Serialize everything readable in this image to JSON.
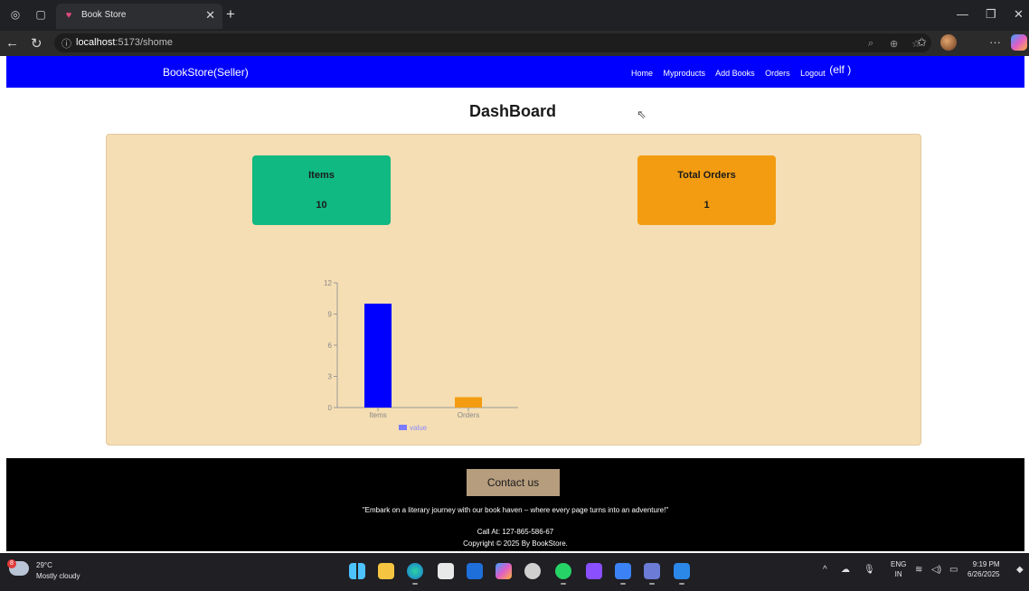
{
  "browser": {
    "tab_title": "Book Store",
    "url_host": "localhost",
    "url_rest": ":5173/shome"
  },
  "navbar": {
    "brand": "BookStore(Seller)",
    "links": [
      "Home",
      "Myproducts",
      "Add Books",
      "Orders",
      "Logout"
    ],
    "logout_suffix": "(elf )"
  },
  "dashboard": {
    "title": "DashBoard",
    "cards": [
      {
        "label": "Items",
        "value": "10",
        "color": "#10b981"
      },
      {
        "label": "Total Orders",
        "value": "1",
        "color": "#f39c12"
      }
    ]
  },
  "chart_data": {
    "type": "bar",
    "categories": [
      "Items",
      "Orders"
    ],
    "values": [
      10,
      1
    ],
    "bar_colors": [
      "#0000ff",
      "#f39c12"
    ],
    "yticks": [
      0,
      3,
      6,
      9,
      12
    ],
    "ylim": [
      0,
      12
    ],
    "legend": "value",
    "title": "",
    "xlabel": "",
    "ylabel": ""
  },
  "footer": {
    "contact_label": "Contact us",
    "quote": "\"Embark on a literary journey with our book haven – where every page turns into an adventure!\"",
    "call": "Call At: 127-865-586-67",
    "copyright": "Copyright © 2025 By BookStore."
  },
  "taskbar": {
    "temperature": "29°C",
    "condition": "Mostly cloudy",
    "weather_badge": "8",
    "lang_top": "ENG",
    "lang_bottom": "IN",
    "time": "9:19 PM",
    "date": "6/26/2025"
  }
}
